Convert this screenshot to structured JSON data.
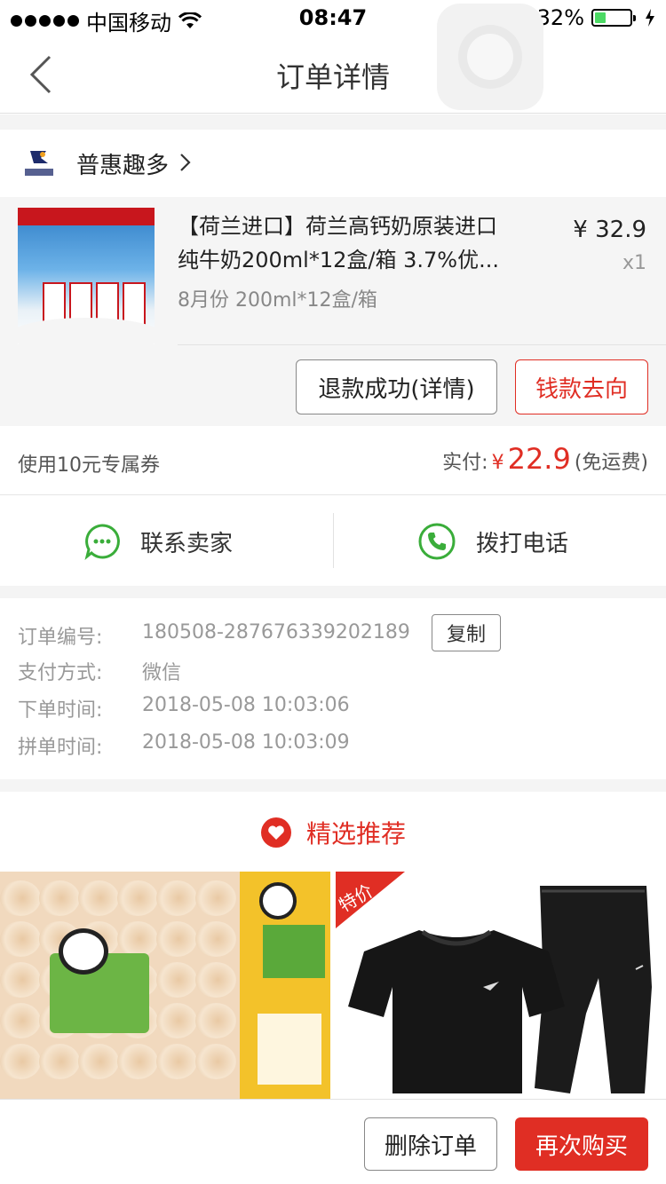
{
  "status_bar": {
    "carrier": "中国移动",
    "time": "08:47",
    "battery": "32%",
    "battery_level": 0.32,
    "icons": [
      "signal-dots-icon",
      "wifi-icon",
      "rotation-lock-icon",
      "alarm-icon",
      "battery-icon",
      "charging-icon"
    ]
  },
  "nav": {
    "title": "订单详情",
    "back_icon": "chevron-left-icon"
  },
  "shop": {
    "name": "普惠趣多"
  },
  "product": {
    "title_line1": "【荷兰进口】荷兰高钙奶原装进口",
    "title_line2": "纯牛奶200ml*12盒/箱 3.7%优...",
    "sku": "8月份 200ml*12盒/箱",
    "price": "¥ 32.9",
    "qty": "x1",
    "refund_button": "退款成功(详情)",
    "money_flow_button": "钱款去向"
  },
  "payment": {
    "coupon": "使用10元专属券",
    "paid_label": "实付:",
    "currency": "¥",
    "amount": "22.9",
    "shipping": "(免运费)"
  },
  "contact": {
    "seller_label": "联系卖家",
    "phone_label": "拨打电话"
  },
  "order_info": {
    "order_no_label": "订单编号:",
    "order_no": "180508-287676339202189",
    "copy_label": "复制",
    "pay_method_label": "支付方式:",
    "pay_method": "微信",
    "order_time_label": "下单时间:",
    "order_time": "2018-05-08 10:03:06",
    "group_time_label": "拼单时间:",
    "group_time": "2018-05-08 10:03:09"
  },
  "recommend": {
    "title": "精选推荐",
    "badge": "特价"
  },
  "bottom_bar": {
    "delete_label": "删除订单",
    "buy_again_label": "再次购买"
  },
  "colors": {
    "accent_red": "#e02e24",
    "wechat_green": "#3aad3a",
    "page_gray": "#f4f4f4"
  }
}
